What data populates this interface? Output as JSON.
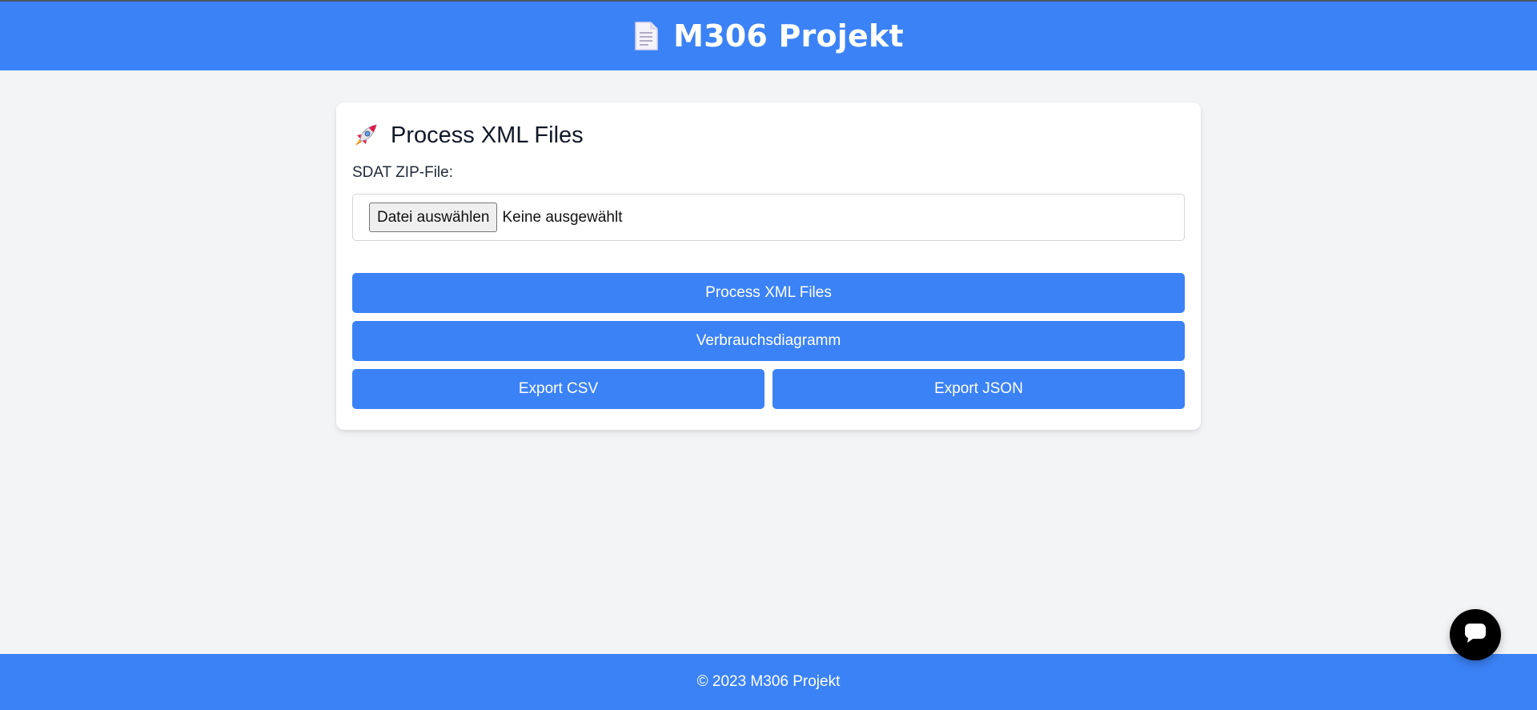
{
  "header": {
    "title": "M306 Projekt",
    "icon": "document-icon"
  },
  "card": {
    "title": "Process XML Files",
    "icon": "rocket-icon",
    "file_label": "SDAT ZIP-File:",
    "file_button": "Datei auswählen",
    "file_status": "Keine ausgewählt",
    "buttons": {
      "process": "Process XML Files",
      "chart": "Verbrauchsdiagramm",
      "export_csv": "Export CSV",
      "export_json": "Export JSON"
    }
  },
  "footer": {
    "text": "© 2023 M306 Projekt"
  },
  "chat": {
    "icon": "chat-bubble-icon"
  },
  "colors": {
    "primary": "#3b82f6",
    "background": "#f3f4f6",
    "card": "#ffffff",
    "chat_button": "#000000"
  }
}
